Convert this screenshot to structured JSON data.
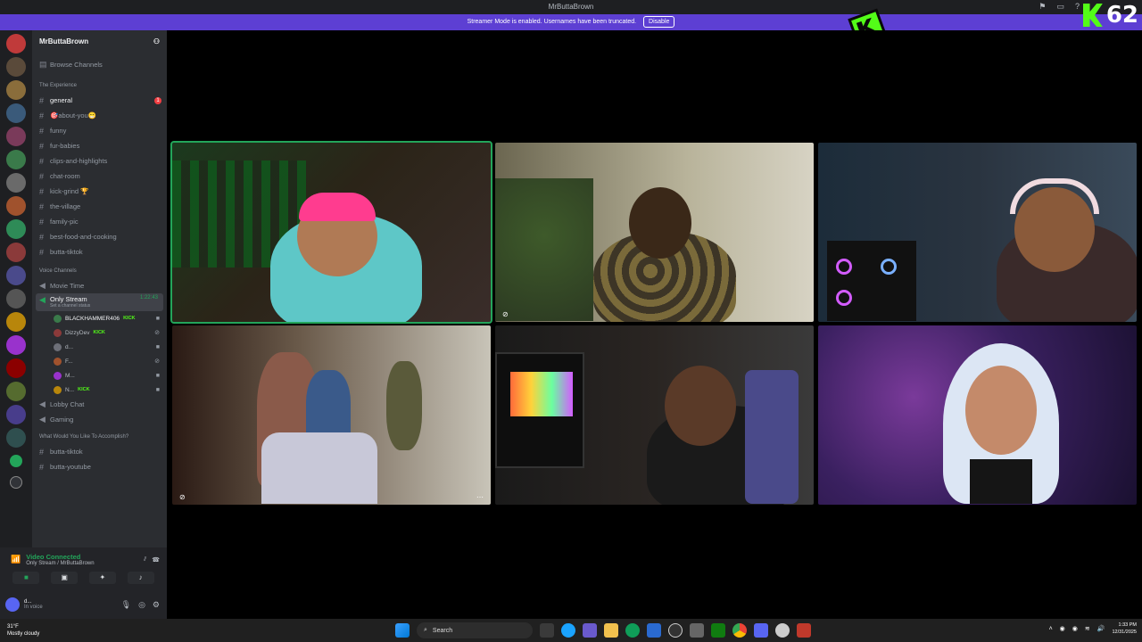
{
  "window": {
    "title": "MrButtaBrown"
  },
  "banner": {
    "text": "Streamer Mode is enabled. Usernames have been truncated.",
    "disable_label": "Disable"
  },
  "overlay": {
    "viewer_count": "62",
    "brand_color": "#53fc18"
  },
  "server": {
    "name": "MrButtaBrown",
    "browse_channels": "Browse Channels"
  },
  "categories": {
    "experience": "The Experience",
    "voice": "Voice Channels",
    "accomplish": "What Would You Like To Accomplish?"
  },
  "text_channels": [
    {
      "name": "general",
      "unread": "1"
    },
    {
      "name": "🎯about-you😁"
    },
    {
      "name": "funny"
    },
    {
      "name": "fur-babies"
    },
    {
      "name": "clips-and-highlights"
    },
    {
      "name": "chat-room"
    },
    {
      "name": "kick-grind 🏆"
    },
    {
      "name": "the-village"
    },
    {
      "name": "family-pic"
    },
    {
      "name": "best-food-and-cooking"
    },
    {
      "name": "butta-tiktok"
    }
  ],
  "voice_channels": {
    "movie_time": "Movie Time",
    "only_stream": "Only Stream",
    "only_stream_time": "1:22:43",
    "only_stream_status": "Set a channel status",
    "lobby_chat": "Lobby Chat",
    "gaming": "Gaming"
  },
  "members": [
    {
      "name": "BLACKHAMMER406",
      "kick": "KICK"
    },
    {
      "name": "DizzyDev",
      "kick": "KICK"
    },
    {
      "name": "d...",
      "kick": ""
    },
    {
      "name": "F...",
      "kick": ""
    },
    {
      "name": "M...",
      "kick": ""
    },
    {
      "name": "N...",
      "kick": "KICK"
    }
  ],
  "bottom_channels": [
    "butta-tiktok",
    "butta-youtube"
  ],
  "voice_panel": {
    "status": "Video Connected",
    "location": "Only Stream / MrButtaBrown",
    "user_name": "d...",
    "user_status": "In voice"
  },
  "taskbar": {
    "weather_temp": "31°F",
    "weather_desc": "Mostly cloudy",
    "search_label": "Search",
    "time": "1:33 PM",
    "date": "12/31/2025"
  }
}
